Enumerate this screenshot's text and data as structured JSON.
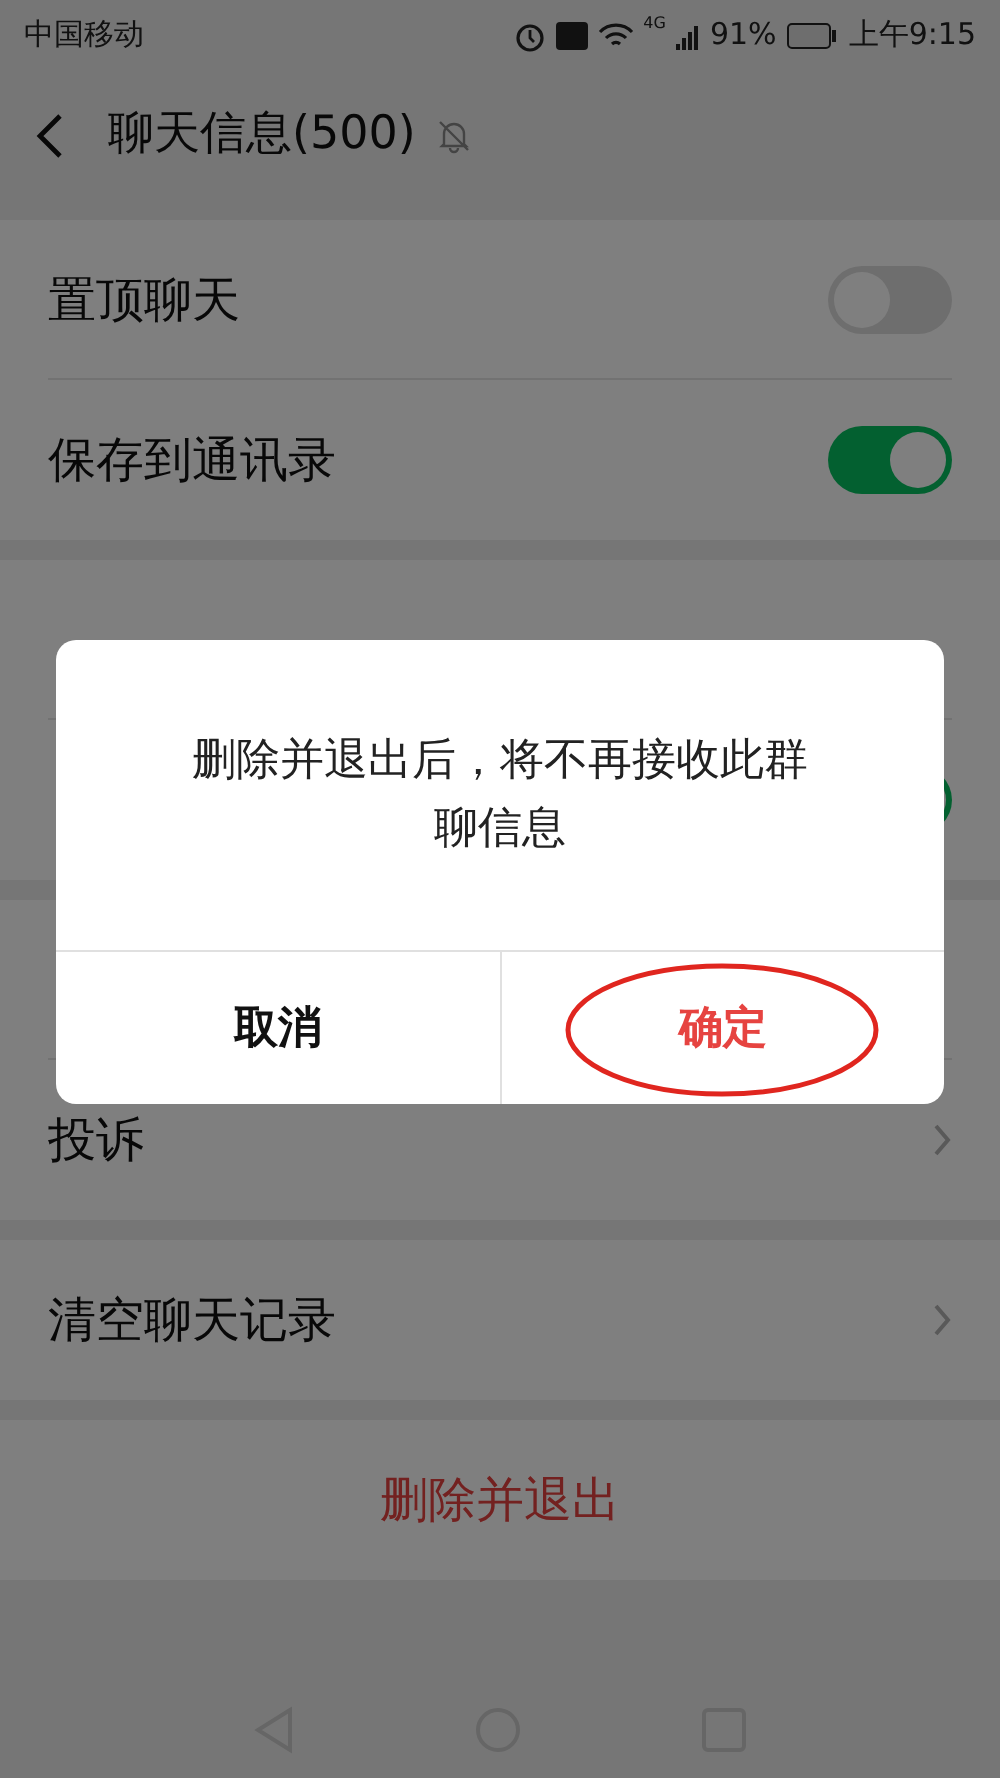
{
  "status_bar": {
    "carrier": "中国移动",
    "network": "4G",
    "battery": "91%",
    "time": "上午9:15"
  },
  "header": {
    "title": "聊天信息(500)",
    "muted": true
  },
  "groups": [
    {
      "rows": [
        {
          "kind": "toggle",
          "label": "置顶聊天",
          "on": false
        },
        {
          "kind": "toggle",
          "label": "保存到通讯录",
          "on": true
        }
      ]
    },
    {
      "rows": [
        {
          "kind": "blank"
        },
        {
          "kind": "toggle",
          "on": true
        }
      ]
    },
    {
      "rows": [
        {
          "kind": "blank"
        },
        {
          "kind": "link",
          "label": "投诉"
        }
      ]
    },
    {
      "rows": [
        {
          "kind": "link",
          "label": "清空聊天记录"
        }
      ]
    },
    {
      "rows": [
        {
          "kind": "danger",
          "label": "删除并退出"
        }
      ]
    }
  ],
  "dialog": {
    "message": "删除并退出后，将不再接收此群聊信息",
    "buttons": [
      {
        "label": "取消",
        "kind": "cancel",
        "circled": false
      },
      {
        "label": "确定",
        "kind": "confirm",
        "circled": true
      }
    ]
  }
}
